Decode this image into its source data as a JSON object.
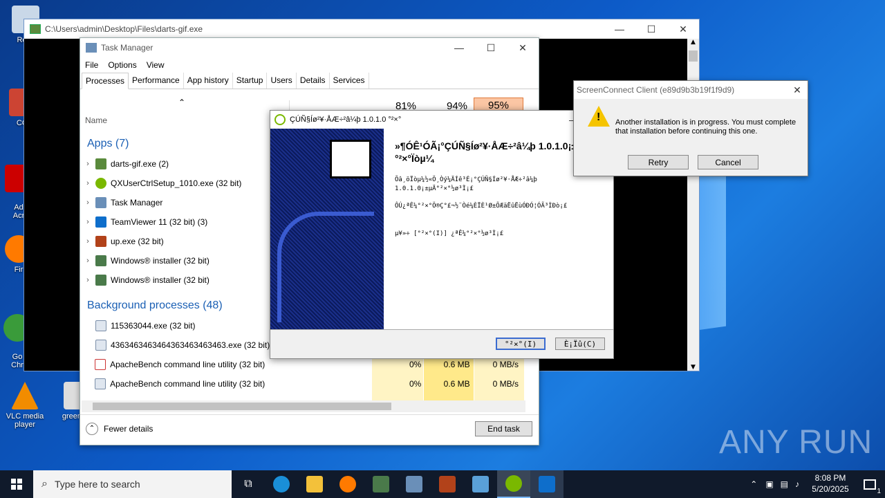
{
  "desktop": {
    "icons": [
      {
        "label": "Recy",
        "color": "#c9d8e8"
      },
      {
        "label": "CCl",
        "color": "#c43"
      },
      {
        "label": "Ad\nAcr",
        "color": "#c00"
      },
      {
        "label": "Fir",
        "color": "#ff7a00"
      },
      {
        "label": "Go\nChr",
        "color": "#3a9b3a"
      },
      {
        "label": "VLC media player",
        "color": "#f28c00"
      },
      {
        "label": "greenp",
        "color": "#ddd"
      }
    ],
    "watermark": "ANY RUN"
  },
  "darts_window": {
    "title": "C:\\Users\\admin\\Desktop\\Files\\darts-gif.exe"
  },
  "task_manager": {
    "title": "Task Manager",
    "menu": [
      "File",
      "Options",
      "View"
    ],
    "tabs": [
      "Processes",
      "Performance",
      "App history",
      "Startup",
      "Users",
      "Details",
      "Services"
    ],
    "col_name": "Name",
    "pct_cpu": "81%",
    "pct_mem": "94%",
    "pct_disk": "95%",
    "apps_header": "Apps (7)",
    "apps": [
      {
        "name": "darts-gif.exe (2)",
        "color": "#5a8a3c"
      },
      {
        "name": "QXUserCtrlSetup_1010.exe (32 bit)",
        "color": "#7ab800"
      },
      {
        "name": "Task Manager",
        "color": "#6a8fb8"
      },
      {
        "name": "TeamViewer 11 (32 bit) (3)",
        "color": "#0e6ecb"
      },
      {
        "name": "up.exe (32 bit)",
        "color": "#b2421a"
      },
      {
        "name": "Windows® installer (32 bit)",
        "color": "#4a7a4a"
      },
      {
        "name": "Windows® installer (32 bit)",
        "color": "#4a7a4a"
      }
    ],
    "bg_header": "Background processes (48)",
    "bg": [
      {
        "name": "115363044.exe (32 bit)",
        "cpu": "",
        "mem": "",
        "disk": ""
      },
      {
        "name": "4363463463464363463463463.exe (32 bit)",
        "cpu": "",
        "mem": "",
        "disk": ""
      },
      {
        "name": "ApacheBench command line utility (32 bit)",
        "cpu": "0%",
        "mem": "0.6 MB",
        "disk": "0 MB/s"
      },
      {
        "name": "ApacheBench command line utility (32 bit)",
        "cpu": "0%",
        "mem": "0.6 MB",
        "disk": "0 MB/s"
      }
    ],
    "fewer_details": "Fewer details",
    "end_task": "End task"
  },
  "installer": {
    "title": "ÇÚÑ§Íø²¥·ÅÆ÷²â¼þ 1.0.1.0 °²×°",
    "heading": "»¶Ó­Ê¹ÓÃ¡°ÇÚÑ§Íø²¥·ÅÆ÷²â¼þ 1.0.1.0¡±°²×°Ïòµ¼",
    "para1": "Õâ¸öÏòµ¼½«Ö¸Òý¼ÄÍê³É¡°ÇÚÑ§Íø²¥·ÅÆ÷²â¼þ 1.0.1.0¡±µÄ°²×°½ø³Ì¡£",
    "para2": "ÔÚ¿ªÊ¼°²×°Ö®Ç°£¬½¨Òé¼ÈÏÈ¹Ø±ÕÆäËûËùÓÐÓ¦ÓÃ³ÌÐò¡£",
    "para3": "µ¥»÷ [°²×°(I)] ¿ªÊ¼°²×°½ø³Ì¡£",
    "install_btn": "°²×°(I)",
    "cancel_btn": "È¡Ïû(C)"
  },
  "screenconnect": {
    "title": "ScreenConnect Client (e89d9b3b19f1f9d9)",
    "message": "Another installation is in progress. You must complete that installation before continuing this one.",
    "retry": "Retry",
    "cancel": "Cancel"
  },
  "taskbar": {
    "search_placeholder": "Type here to search",
    "time": "8:08 PM",
    "date": "5/20/2025",
    "notif_count": "1"
  }
}
